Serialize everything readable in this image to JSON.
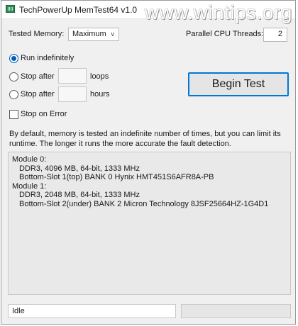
{
  "window": {
    "title": "TechPowerUp MemTest64 v1.0",
    "watermark": "www.wintips.org"
  },
  "settings": {
    "tested_memory_label": "Tested Memory:",
    "tested_memory_value": "Maximum",
    "threads_label": "Parallel CPU Threads:",
    "threads_value": "2"
  },
  "run_options": {
    "run_indefinitely": "Run indefinitely",
    "stop_after": "Stop after",
    "loops_unit": "loops",
    "hours_unit": "hours",
    "loops_value": "",
    "hours_value": "",
    "selected": "run_indefinitely",
    "stop_on_error": "Stop on Error",
    "stop_on_error_checked": false
  },
  "actions": {
    "begin_test": "Begin Test"
  },
  "description": "By default, memory is tested an indefinite number of times, but you can limit its runtime. The longer it runs the more accurate the fault detection.",
  "modules": [
    {
      "header": "Module 0:",
      "spec": "DDR3, 4096 MB, 64-bit, 1333 MHz",
      "slot": "Bottom-Slot 1(top) BANK 0 Hynix HMT451S6AFR8A-PB"
    },
    {
      "header": "Module 1:",
      "spec": "DDR3, 2048 MB, 64-bit, 1333 MHz",
      "slot": "Bottom-Slot 2(under) BANK 2 Micron Technology 8JSF25664HZ-1G4D1"
    }
  ],
  "status": {
    "text": "Idle",
    "progress": 0
  },
  "colors": {
    "accent": "#005fb8",
    "button_border": "#0078d4"
  },
  "icons": {
    "app": "memtest-chip-icon",
    "dropdown": "chevron-down-icon"
  }
}
